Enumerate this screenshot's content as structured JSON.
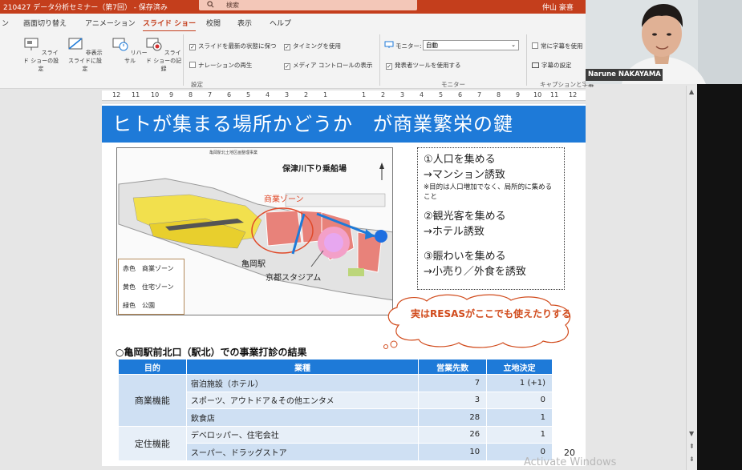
{
  "titlebar": {
    "doc_title": "210427 データ分析セミナー（第7回） - 保存済み",
    "search_placeholder": "検索",
    "user_name": "仲山 豪喜"
  },
  "ribbon_tabs": [
    "ン",
    "画面切り替え",
    "アニメーション",
    "スライド ショー",
    "校閲",
    "表示",
    "ヘルプ"
  ],
  "active_tab": "スライド ショー",
  "ribbon": {
    "setup_show": "スライド ショーの設定",
    "hide_slide": "非表示スライドに設定",
    "rehearse": "リハーサル",
    "record": "スライド ショーの記録",
    "chk_keep_updated": "スライドを最新の状態に保つ",
    "chk_use_timings": "タイミングを使用",
    "chk_narration": "ナレーションの再生",
    "chk_media_controls": "メディア コントロールの表示",
    "group_setup": "設定",
    "monitor_label": "モニター:",
    "monitor_value": "自動",
    "chk_presenter_view": "発表者ツールを使用する",
    "group_monitor": "モニター",
    "chk_always_captions": "常に字幕を使用",
    "caption_settings": "字幕の設定",
    "group_captions": "キャプションと字幕"
  },
  "ruler_ticks": [
    "12",
    "11",
    "10",
    "9",
    "8",
    "7",
    "6",
    "5",
    "4",
    "3",
    "2",
    "1",
    "1",
    "2",
    "3",
    "4",
    "5",
    "6",
    "7",
    "8",
    "9",
    "10",
    "11",
    "12"
  ],
  "slide": {
    "title": "ヒトが集まる場所かどうか　が商業繁栄の鍵",
    "map": {
      "small_title": "亀岡駅北土地区画整理事業",
      "label_boat": "保津川下り乗船場",
      "label_commercial": "商業ゾーン",
      "label_station": "亀岡駅",
      "label_stadium": "京都スタジアム",
      "legend": [
        "赤色　商業ゾーン",
        "黄色　住宅ゾーン",
        "緑色　公園"
      ]
    },
    "points": {
      "p1_a": "①人口を集める",
      "p1_b": "→マンション誘致",
      "p1_note": "※目的は人口増加でなく、局所的に集めること",
      "p2_a": "②観光客を集める",
      "p2_b": "→ホテル誘致",
      "p3_a": "③賑わいを集める",
      "p3_b": "→小売り／外食を誘致"
    },
    "callout": "実はRESASがここでも使えたりする",
    "subheading": "○亀岡駅前北口（駅北）での事業打診の結果",
    "table": {
      "headers": [
        "目的",
        "業種",
        "営業先数",
        "立地決定"
      ],
      "groups": [
        "商業機能",
        "定住機能"
      ],
      "rows": [
        {
          "industry": "宿泊施設（ホテル）",
          "count": "7",
          "decided": "1 (+1)"
        },
        {
          "industry": "スポーツ、アウトドア＆その他エンタメ",
          "count": "3",
          "decided": "0"
        },
        {
          "industry": "飲食店",
          "count": "28",
          "decided": "1"
        },
        {
          "industry": "デベロッパー、住宅会社",
          "count": "26",
          "decided": "1"
        },
        {
          "industry": "スーパー、ドラッグストア",
          "count": "10",
          "decided": "0"
        }
      ]
    },
    "page_number": "20"
  },
  "webcam": {
    "participant_name": "Narune NAKAYAMA"
  },
  "watermark": "Activate Windows",
  "colors": {
    "accent": "#c43e1c",
    "slide_blue": "#1e7ad8",
    "callout_orange": "#d14b1c"
  }
}
